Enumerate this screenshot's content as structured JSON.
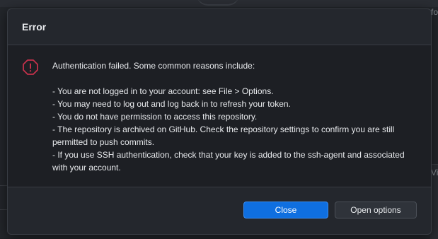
{
  "background": {
    "edge_text_top_right": "fo",
    "edge_text_mid_right": "Vis"
  },
  "dialog": {
    "title": "Error",
    "icon": "error-circle-icon",
    "message_lines": [
      "Authentication failed. Some common reasons include:",
      "",
      "- You are not logged in to your account: see File > Options.",
      "- You may need to log out and log back in to refresh your token.",
      "- You do not have permission to access this repository.",
      "- The repository is archived on GitHub. Check the repository settings to confirm you are still",
      "permitted to push commits.",
      "- If you use SSH authentication, check that your key is added to the ssh-agent and associated",
      "with your account."
    ],
    "buttons": {
      "close": "Close",
      "open_options": "Open options"
    }
  },
  "colors": {
    "accent": "#0f6fe0",
    "error": "#c4314b",
    "dialog_bg": "#24272d",
    "body_bg": "#1d1f24"
  }
}
